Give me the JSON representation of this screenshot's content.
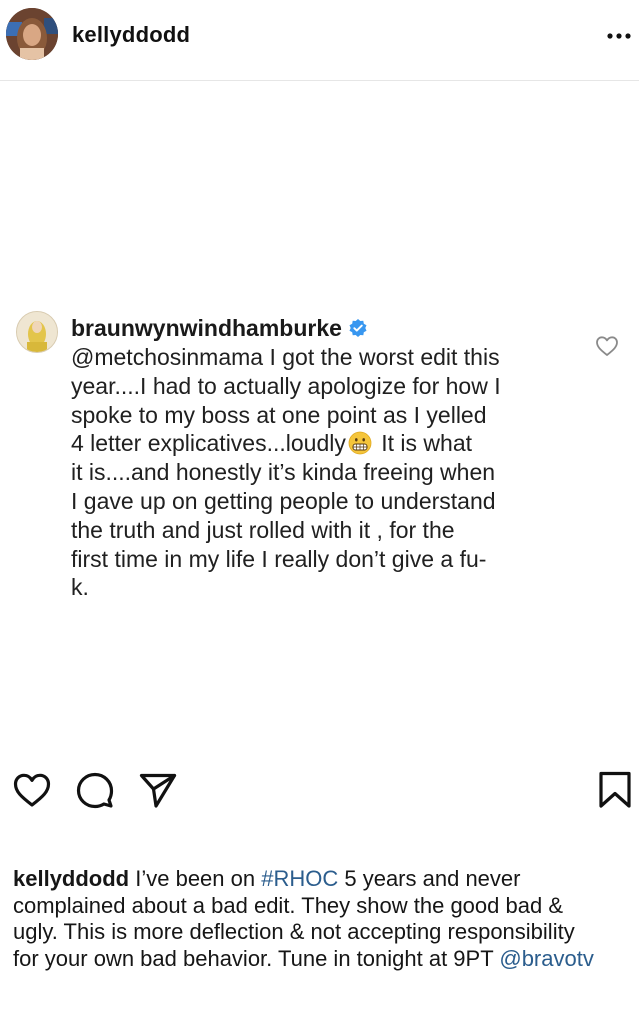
{
  "post": {
    "author_username": "kellyddodd",
    "menu_icon": "more-horizontal-icon"
  },
  "media": {
    "comment": {
      "username": "braunwynwindhamburke",
      "verified": true,
      "mention": "@metchosinmama",
      "lines": [
        " I got the worst edit this",
        "year....I had to actually apologize for how I",
        "spoke to my boss at one point as I yelled",
        "4 letter explicatives...loudly",
        " It is what",
        "it is....and honestly it’s kinda freeing when",
        "I gave up on getting people to understand",
        "the truth and just rolled with it , for the",
        "first time in my life I really don’t give a fu-",
        "k."
      ],
      "emoji": "grimacing-face-emoji",
      "like_icon": "heart-outline-icon"
    }
  },
  "actions": {
    "like_icon": "heart-outline-icon",
    "comment_icon": "comment-bubble-icon",
    "share_icon": "paper-plane-icon",
    "save_icon": "bookmark-icon"
  },
  "caption": {
    "username": "kellyddodd",
    "segments": {
      "part1": " I’ve been on ",
      "hashtag": "#RHOC",
      "part2": " 5 years and never"
    },
    "line2": "complained about a bad edit. They show the good bad &",
    "line3": "ugly. This is more deflection & not accepting responsibility",
    "line4_text": "for your own bad behavior. Tune in tonight at 9PT ",
    "line4_mention": "@bravotv"
  },
  "colors": {
    "link": "#2b5d8d",
    "verified": "#3897f0",
    "text": "#111111"
  }
}
